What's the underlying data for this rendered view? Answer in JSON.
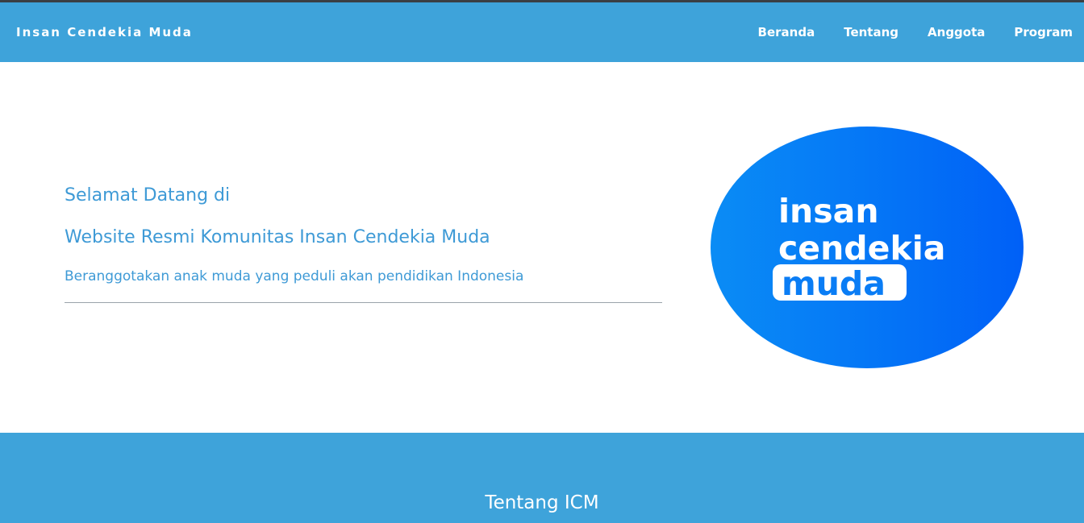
{
  "navbar": {
    "brand": "Insan Cendekia Muda",
    "links": [
      "Beranda",
      "Tentang",
      "Anggota",
      "Program"
    ],
    "background_color": "#3ea3da"
  },
  "hero": {
    "title_line_1": "Selamat Datang di",
    "title_line_2": "Website Resmi Komunitas Insan Cendekia Muda",
    "subtitle": "Beranggotakan anak muda yang peduli akan pendidikan Indonesia",
    "text_color": "#3e9ad6",
    "logo": {
      "words": [
        "insan",
        "cendekia",
        "muda"
      ],
      "colors": [
        "#0a8cf5",
        "#0060f7"
      ]
    }
  },
  "about": {
    "title": "Tentang ICM"
  }
}
